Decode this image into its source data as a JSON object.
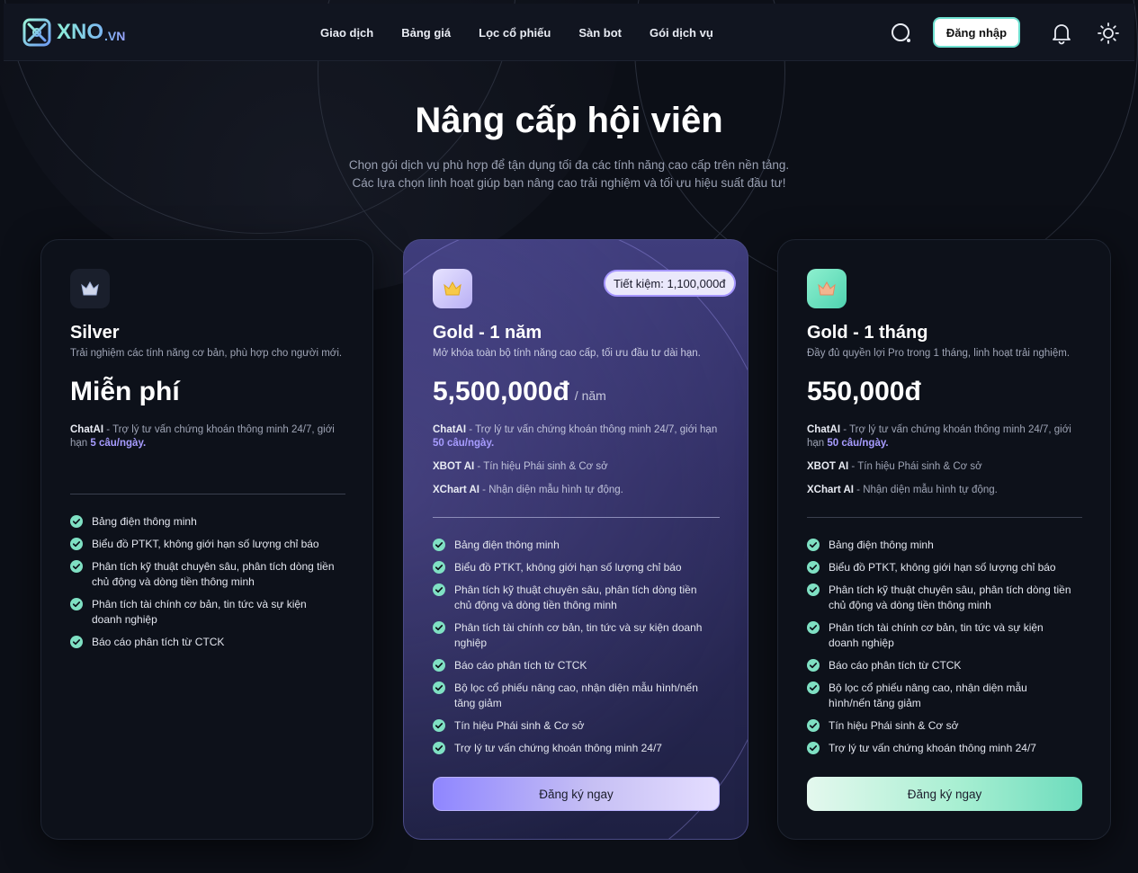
{
  "header": {
    "logo_text": "XNO",
    "logo_suffix": ".VN",
    "nav": [
      "Giao dịch",
      "Bảng giá",
      "Lọc cổ phiếu",
      "Sàn bot",
      "Gói dịch vụ"
    ],
    "login_label": "Đăng nhập",
    "icons": [
      "search-icon",
      "bell-icon",
      "sun-icon"
    ]
  },
  "hero": {
    "title": "Nâng cấp hội viên",
    "subtitle_line1": "Chọn gói dịch vụ phù hợp để tận dụng tối đa các tính năng cao cấp trên nền tảng.",
    "subtitle_line2": "Các lựa chọn linh hoạt giúp bạn nâng cao trải nghiệm và tối ưu hiệu suất đầu tư!"
  },
  "plans": [
    {
      "name": "Silver",
      "description": "Trải nghiệm các tính năng cơ bản, phù hợp cho người mới.",
      "price": "Miễn phí",
      "features": [
        {
          "title": "ChatAI",
          "text": " - Trợ lý tư vấn chứng khoán thông minh 24/7, giới hạn ",
          "highlight": "5 câu/ngày."
        }
      ],
      "bullets": [
        "Bảng điện thông minh",
        "Biểu đồ PTKT, không giới hạn số lượng chỉ báo",
        "Phân tích kỹ thuật chuyên sâu, phân tích dòng tiền chủ động và dòng tiền thông minh",
        "Phân tích tài chính cơ bản, tin tức và sự kiện doanh nghiệp",
        "Báo cáo phân tích từ CTCK"
      ]
    },
    {
      "name": "Gold - 1 năm",
      "description": "Mở khóa toàn bộ tính năng cao cấp, tối ưu đầu tư dài hạn.",
      "price": "5,500,000đ",
      "period": "/ năm",
      "badge": "Tiết kiệm: 1,100,000đ",
      "features": [
        {
          "title": "ChatAI",
          "text": " - Trợ lý tư vấn chứng khoán thông minh 24/7, giới hạn ",
          "highlight": "50 câu/ngày."
        },
        {
          "title": "XBOT AI",
          "text": " - Tín hiệu Phái sinh & Cơ sở",
          "highlight": ""
        },
        {
          "title": "XChart AI",
          "text": " - Nhận diện mẫu hình tự động.",
          "highlight": ""
        }
      ],
      "bullets": [
        "Bảng điện thông minh",
        "Biểu đồ PTKT, không giới hạn số lượng chỉ báo",
        "Phân tích kỹ thuật chuyên sâu, phân tích dòng tiền chủ động và dòng tiền thông minh",
        "Phân tích tài chính cơ bản, tin tức và sự kiện doanh nghiệp",
        "Báo cáo phân tích từ CTCK",
        "Bộ lọc cổ phiếu nâng cao, nhận diện mẫu hình/nến tăng giảm",
        "Tín hiệu Phái sinh & Cơ sở",
        "Trợ lý tư vấn chứng khoán thông minh 24/7"
      ],
      "cta": "Đăng ký ngay"
    },
    {
      "name": "Gold - 1 tháng",
      "description": "Đầy đủ quyền lợi Pro trong 1 tháng, linh hoạt trải nghiệm.",
      "price": "550,000đ",
      "features": [
        {
          "title": "ChatAI",
          "text": " - Trợ lý tư vấn chứng khoán thông minh 24/7, giới hạn ",
          "highlight": "50 câu/ngày."
        },
        {
          "title": "XBOT AI",
          "text": " - Tín hiệu Phái sinh & Cơ sở",
          "highlight": ""
        },
        {
          "title": "XChart AI",
          "text": " - Nhận diện mẫu hình tự động.",
          "highlight": ""
        }
      ],
      "bullets": [
        "Bảng điện thông minh",
        "Biểu đồ PTKT, không giới hạn số lượng chỉ báo",
        "Phân tích kỹ thuật chuyên sâu, phân tích dòng tiền chủ động và dòng tiền thông minh",
        "Phân tích tài chính cơ bản, tin tức và sự kiện doanh nghiệp",
        "Báo cáo phân tích từ CTCK",
        "Bộ lọc cổ phiếu nâng cao, nhận diện mẫu hình/nến tăng giảm",
        "Tín hiệu Phái sinh & Cơ sở",
        "Trợ lý tư vấn chứng khoán thông minh 24/7"
      ],
      "cta": "Đăng ký ngay"
    }
  ],
  "colors": {
    "background": "#0c0f17",
    "accent_purple": "#a79cff",
    "accent_green": "#6ddcbd",
    "check": "#7fe0c3"
  }
}
